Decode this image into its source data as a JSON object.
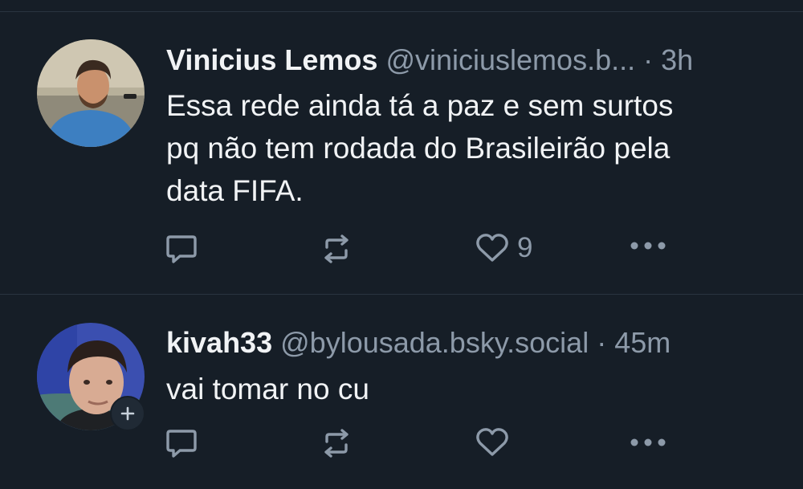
{
  "posts": [
    {
      "name": "Vinicius Lemos",
      "handle": "@viniciuslemos.b...",
      "separator": "·",
      "time": "3h",
      "text_lines": [
        "Essa rede ainda tá a paz e sem surtos",
        "pq não tem rodada do Brasileirão pela",
        "data FIFA."
      ],
      "likes": "9"
    },
    {
      "name": "kivah33",
      "handle": "@bylousada.bsky.social",
      "separator": "·",
      "time": "45m",
      "text_lines": [
        "vai tomar no cu"
      ],
      "likes": ""
    }
  ],
  "icons": {
    "reply": "reply-icon",
    "repost": "repost-icon",
    "like": "heart-icon",
    "more": "more-options-icon",
    "follow": "plus-icon"
  },
  "colors": {
    "background": "#161e27",
    "text_primary": "#f1f3f5",
    "text_secondary": "#8d9aa9",
    "divider": "#2a3440"
  }
}
